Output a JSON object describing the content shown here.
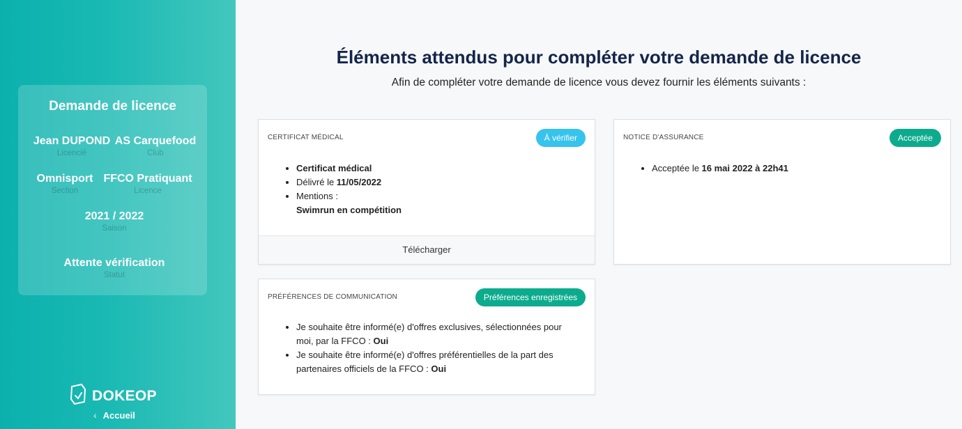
{
  "sidebar": {
    "card_title": "Demande de licence",
    "fields": [
      {
        "value": "Jean DUPOND",
        "label": "Licencié"
      },
      {
        "value": "AS Carquefood",
        "label": "Club"
      },
      {
        "value": "Omnisport",
        "label": "Section"
      },
      {
        "value": "FFCO Pratiquant",
        "label": "Licence"
      },
      {
        "value": "2021 / 2022",
        "label": "Saison"
      },
      {
        "value": "Attente vérification",
        "label": "Statut"
      }
    ],
    "brand": "DOKEOP",
    "back_label": "Accueil"
  },
  "main": {
    "title": "Éléments attendus pour compléter votre demande de licence",
    "subtitle": "Afin de compléter votre demande de licence vous devez fournir les éléments suivants :",
    "cards": {
      "medical": {
        "label": "Certificat médical",
        "badge": "À vérifier",
        "item1": "Certificat médical",
        "item2_prefix": "Délivré le ",
        "item2_value": "11/05/2022",
        "item3_prefix": "Mentions :",
        "item3_value": "Swimrun en compétition",
        "download": "Télécharger"
      },
      "insurance": {
        "label": "Notice d'assurance",
        "badge": "Acceptée",
        "item1_prefix": "Acceptée le ",
        "item1_value": "16 mai 2022 à 22h41"
      },
      "communication": {
        "label": "Préférences de communication",
        "badge": "Préférences enregistrées",
        "item1_prefix": "Je souhaite être informé(e) d'offres exclusives, sélectionnées pour moi, par la FFCO : ",
        "item1_value": "Oui",
        "item2_prefix": "Je souhaite être informé(e) d'offres préférentielles de la part des partenaires officiels de la FFCO : ",
        "item2_value": "Oui"
      }
    }
  },
  "colors": {
    "accent_teal": "#1ab9b3",
    "badge_blue": "#36c3ec",
    "badge_green": "#0dab8d",
    "heading": "#13254a"
  }
}
